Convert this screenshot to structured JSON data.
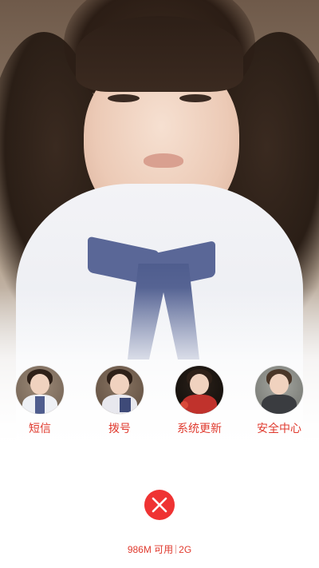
{
  "apps": [
    {
      "label": "短信",
      "icon": "sms-app-icon",
      "theme": {
        "bg": "#7a6a5c",
        "body": "#eef0f5"
      }
    },
    {
      "label": "拨号",
      "icon": "dialer-app-icon",
      "theme": {
        "bg": "#6e5a48",
        "body": "#e8e8ee"
      }
    },
    {
      "label": "系统更新",
      "icon": "system-update-app-icon",
      "theme": {
        "bg": "#1a1410",
        "body": "#c0322c"
      }
    },
    {
      "label": "安全中心",
      "icon": "security-center-app-icon",
      "theme": {
        "bg": "#8d8f8a",
        "body": "#3a3c40"
      }
    }
  ],
  "memory": {
    "available": "986M 可用",
    "total": "2G"
  },
  "close_icon": "close-x-icon",
  "colors": {
    "accent": "#e03a2e",
    "close_button": "#ef3333"
  }
}
